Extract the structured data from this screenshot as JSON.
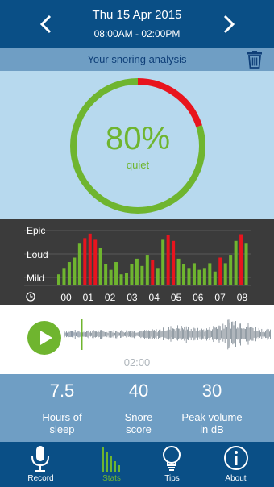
{
  "header": {
    "date": "Thu 15 Apr 2015",
    "time_range": "08:00AM - 02:00PM",
    "prev_icon": "chevron-left-icon",
    "next_icon": "chevron-right-icon"
  },
  "analysis": {
    "title": "Your snoring analysis",
    "delete_icon": "trash-icon",
    "percent_text": "80%",
    "percent_label": "quiet",
    "quiet_fraction": 0.8,
    "colors": {
      "quiet": "#6fb52f",
      "snore": "#e8141e"
    }
  },
  "chart_data": {
    "type": "bar",
    "y_levels": [
      "Epic",
      "Loud",
      "Mild"
    ],
    "time_icon": "clock-icon",
    "x_ticks": [
      "00",
      "01",
      "02",
      "03",
      "04",
      "05",
      "06",
      "07",
      "08"
    ],
    "bars": [
      {
        "level": 0.2,
        "snore": false
      },
      {
        "level": 0.3,
        "snore": false
      },
      {
        "level": 0.42,
        "snore": false
      },
      {
        "level": 0.5,
        "snore": false
      },
      {
        "level": 0.75,
        "snore": false
      },
      {
        "level": 0.85,
        "snore": true
      },
      {
        "level": 0.93,
        "snore": true
      },
      {
        "level": 0.82,
        "snore": true
      },
      {
        "level": 0.68,
        "snore": false
      },
      {
        "level": 0.38,
        "snore": false
      },
      {
        "level": 0.28,
        "snore": false
      },
      {
        "level": 0.42,
        "snore": false
      },
      {
        "level": 0.2,
        "snore": false
      },
      {
        "level": 0.23,
        "snore": false
      },
      {
        "level": 0.38,
        "snore": false
      },
      {
        "level": 0.48,
        "snore": false
      },
      {
        "level": 0.35,
        "snore": false
      },
      {
        "level": 0.55,
        "snore": false
      },
      {
        "level": 0.45,
        "snore": true
      },
      {
        "level": 0.3,
        "snore": false
      },
      {
        "level": 0.82,
        "snore": false
      },
      {
        "level": 0.9,
        "snore": true
      },
      {
        "level": 0.8,
        "snore": true
      },
      {
        "level": 0.48,
        "snore": false
      },
      {
        "level": 0.38,
        "snore": false
      },
      {
        "level": 0.3,
        "snore": false
      },
      {
        "level": 0.4,
        "snore": false
      },
      {
        "level": 0.28,
        "snore": false
      },
      {
        "level": 0.3,
        "snore": false
      },
      {
        "level": 0.4,
        "snore": false
      },
      {
        "level": 0.25,
        "snore": false
      },
      {
        "level": 0.5,
        "snore": true
      },
      {
        "level": 0.4,
        "snore": false
      },
      {
        "level": 0.55,
        "snore": false
      },
      {
        "level": 0.8,
        "snore": false
      },
      {
        "level": 0.92,
        "snore": true
      },
      {
        "level": 0.75,
        "snore": false
      }
    ]
  },
  "recording": {
    "play_icon": "play-icon",
    "elapsed": "02:00",
    "playhead_fraction": 0.08
  },
  "stats": [
    {
      "value": "7.5",
      "label_line1": "Hours of",
      "label_line2": "sleep"
    },
    {
      "value": "40",
      "label_line1": "Snore",
      "label_line2": "score"
    },
    {
      "value": "30",
      "label_line1": "Peak volume",
      "label_line2": "in dB"
    }
  ],
  "nav": [
    {
      "label": "Record",
      "icon": "microphone-icon",
      "active": false
    },
    {
      "label": "Stats",
      "icon": "stats-icon",
      "active": true
    },
    {
      "label": "Tips",
      "icon": "lightbulb-icon",
      "active": false
    },
    {
      "label": "About",
      "icon": "info-icon",
      "active": false
    }
  ]
}
